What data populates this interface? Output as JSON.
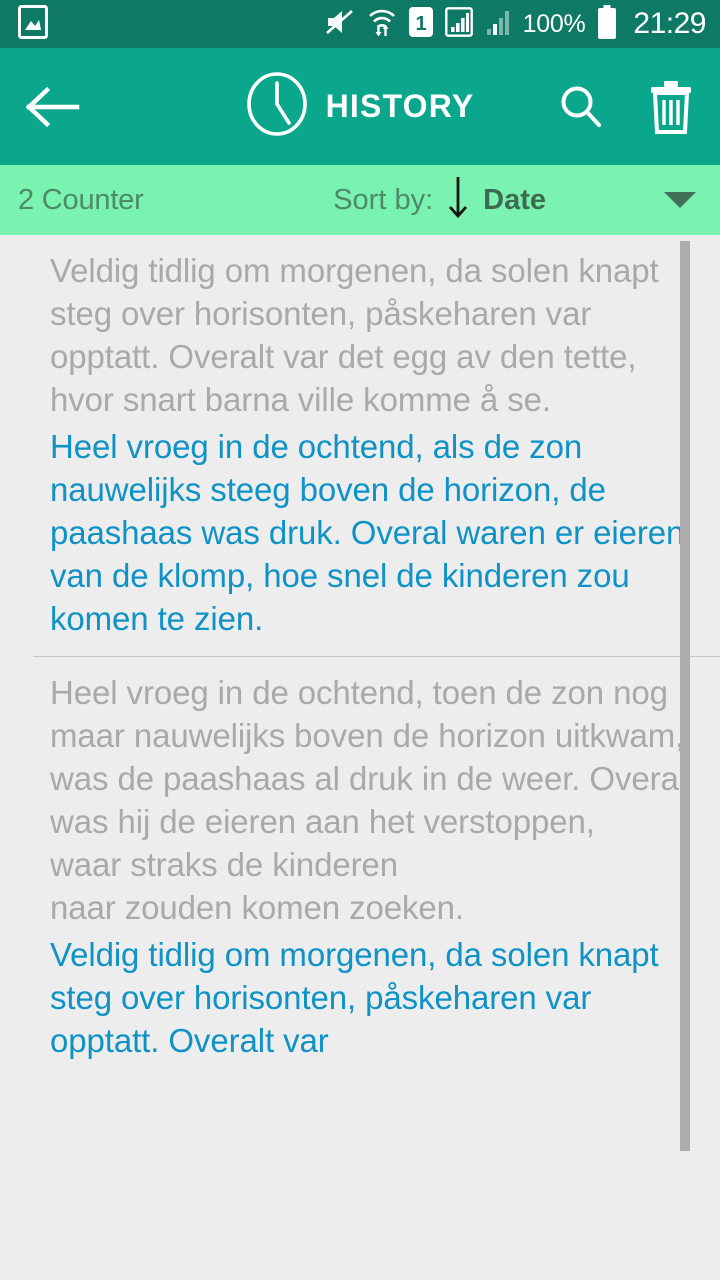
{
  "status_bar": {
    "icons": [
      "gallery-icon",
      "sound-muted-icon",
      "wifi-transfer-icon",
      "sim-1-icon",
      "signal-bars-1-icon",
      "signal-bars-2-icon"
    ],
    "battery_percent": "100%",
    "battery_icon": "battery-full-icon",
    "clock": "21:29",
    "background": "#0e7a66"
  },
  "app_bar": {
    "back_icon": "back-arrow-icon",
    "title_icon": "clock-icon",
    "title": "HISTORY",
    "search_icon": "search-icon",
    "delete_icon": "trash-icon",
    "background": "#0aa78c"
  },
  "sort_bar": {
    "counter": "2 Counter",
    "sort_by_label": "Sort by:",
    "sort_direction_icon": "arrow-down-icon",
    "sort_value": "Date",
    "dropdown_icon": "chevron-down-icon",
    "background": "#7af2b0"
  },
  "colors": {
    "source_text": "#a9a9a9",
    "target_text": "#0f92c6",
    "list_background": "#ededed",
    "divider": "#c6c6c6",
    "scrollbar": "#adadad"
  },
  "history": {
    "items": [
      {
        "source": "Veldig tidlig om morgenen, da solen knapt steg over horisonten, påskeharen var opptatt. Overalt var det egg av den tette, hvor snart barna ville komme å se.",
        "target": "Heel vroeg in de ochtend, als de zon nauwelijks steeg boven de horizon, de paashaas was druk. Overal waren er eieren van de klomp, hoe snel de kinderen zou komen te zien."
      },
      {
        "source": "Heel vroeg in de ochtend, toen de zon nog maar nauwelijks boven de horizon uitkwam, was de paashaas al druk in de weer. Overal was hij de eieren aan het verstoppen,\nwaar straks de kinderen\nnaar zouden komen zoeken.",
        "target": "Veldig tidlig om morgenen, da solen knapt steg over horisonten, påskeharen var opptatt. Overalt var"
      }
    ]
  }
}
